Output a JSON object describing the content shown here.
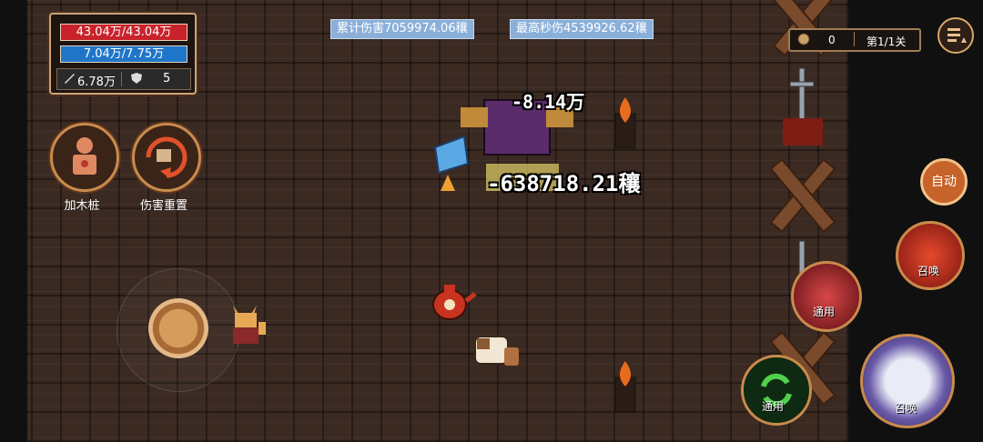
{
  "player": {
    "hp_text": "43.04万/43.04万",
    "mp_text": "7.04万/7.75万",
    "attack": "6.78万",
    "defense": "5",
    "hp_fraction": 1.0,
    "mp_fraction": 0.908
  },
  "left_buttons": [
    {
      "label": "加木桩"
    },
    {
      "label": "伤害重置"
    }
  ],
  "stats_top": {
    "total_damage_prefix": "累计伤害",
    "total_damage_value": "7059974.06穰",
    "max_dps_prefix": "最高秒伤",
    "max_dps_value": "4539926.62穰"
  },
  "hud_right": {
    "coins": "0",
    "stage": "第1/1关",
    "auto_label": "自动"
  },
  "skills": [
    {
      "label": "召唤"
    },
    {
      "label": "通用"
    },
    {
      "label": "通用"
    },
    {
      "label": "召唤"
    }
  ],
  "floating_damage": [
    {
      "text": "-8.14万"
    },
    {
      "text": "-638718.21穰"
    }
  ],
  "colors": {
    "hp": "#c8232b",
    "mp": "#1f76c9",
    "accent": "#c98b4c",
    "info_label": "#8ab0d9"
  },
  "icons": [
    "sword-icon",
    "shield-icon",
    "coin-icon",
    "menu-icon",
    "dummy-icon",
    "reset-icon",
    "refresh-icon",
    "torch-icon"
  ]
}
